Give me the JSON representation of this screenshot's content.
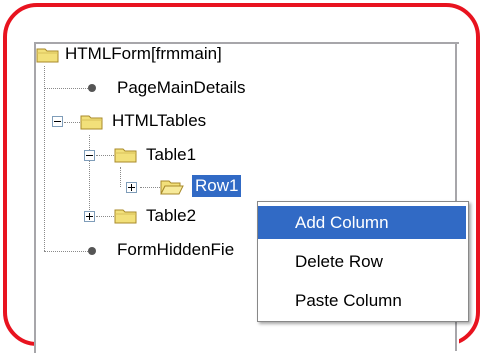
{
  "tree": {
    "root": "HTMLForm[frmmain]",
    "page_main_details": "PageMainDetails",
    "html_tables": "HTMLTables",
    "table1": "Table1",
    "row1": "Row1",
    "table2": "Table2",
    "form_hidden_fields": "FormHiddenFie"
  },
  "context_menu": {
    "items": [
      "Add Column",
      "Delete Row",
      "Paste Column"
    ]
  },
  "colors": {
    "frame_border": "#e8131f",
    "selection": "#316ac5",
    "folder_fill": "#f2e07a"
  },
  "icons": {
    "folder": "folder-icon",
    "leaf": "bullet-icon",
    "expand": "plus-icon",
    "collapse": "minus-icon"
  }
}
